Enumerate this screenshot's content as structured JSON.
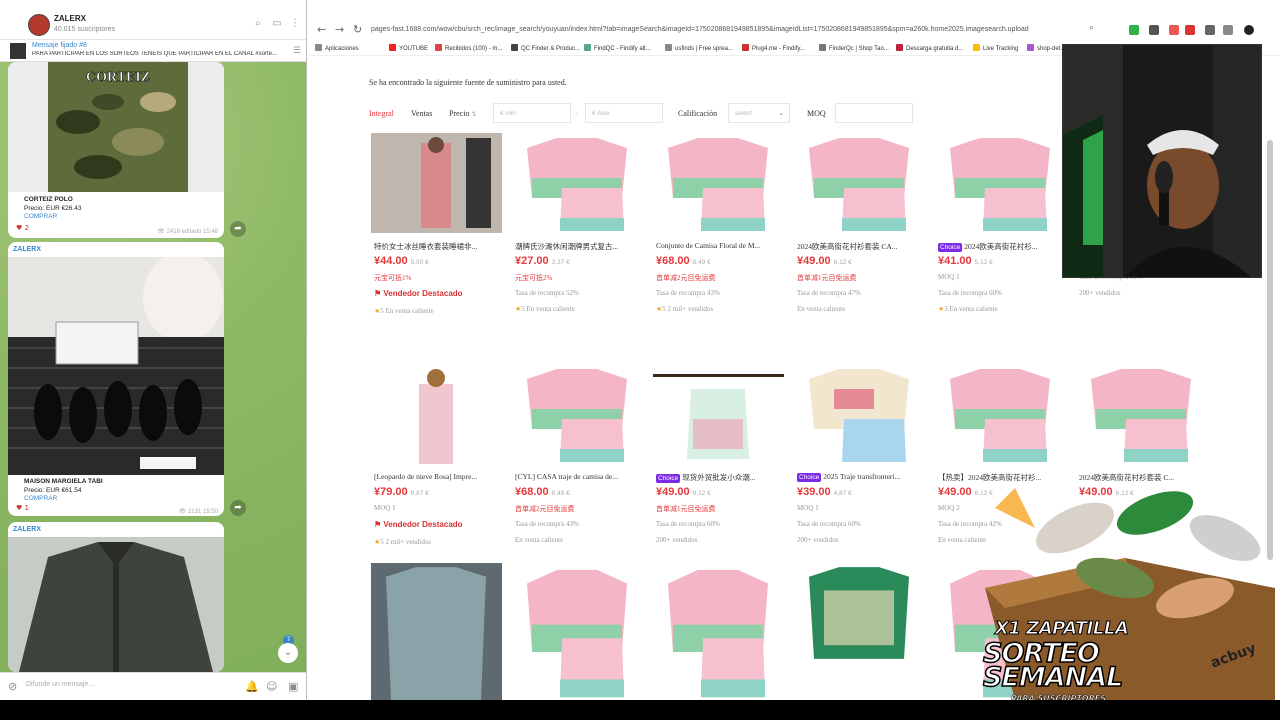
{
  "telegram": {
    "channel": "ZALERX",
    "subscribers": "40.015 suscriptores",
    "pinned_title": "Mensaje fijado #8",
    "pinned_text": "PARA PARTICIPAR EN LOS SORTEOS TENÉIS QUE PARTICIPAR EN EL CANAL #sorte...",
    "messages": [
      {
        "sender": "",
        "brand_text": "CORTEIZ",
        "name": "CORTEIZ POLO",
        "price": "Precio: EUR €26.43",
        "link": "COMPRAR",
        "views": "2419",
        "time": "editado 15:48",
        "reactions": "2"
      },
      {
        "sender": "ZALERX",
        "brand_text": "",
        "name": "MAISON MARGIELA TABI",
        "price": "Precio: EUR €61.54",
        "link": "COMPRAR",
        "views": "2131",
        "time": "15:50",
        "reactions": "1"
      },
      {
        "sender": "ZALERX",
        "brand_text": "",
        "name": "",
        "price": "",
        "link": "",
        "views": "",
        "time": "",
        "reactions": ""
      }
    ],
    "input_placeholder": "Difunde un mensaje...",
    "unread": "7"
  },
  "browser": {
    "url": "pages-fast.1688.com/wow/cbu/srch_rec/image_search/youyuan/index.html?tab=imageSearch&imageId=1750208681949851895&imageIdList=1750208681949851895&spm=a260k.home2025.imagesearch.upload",
    "bookmarks": [
      "Aplicaciones",
      "YOUTUBE",
      "Recibidos (100) - m...",
      "QC Finder & Produc...",
      "FindQC - Findify alt...",
      "usfinds | Free sprea...",
      "Plug4.me - Findify...",
      "FinderQc | Shop Tao...",
      "Descarga gratuita d...",
      "Live Tracking",
      "shop-det..."
    ]
  },
  "search": {
    "found_text": "Se ha encontrado la siguiente fuente de suministro para usted.",
    "sort_integral": "Integral",
    "sort_sales": "Ventas",
    "sort_price": "Precio",
    "min_placeholder": "€ min",
    "max_placeholder": "€ max",
    "rating_label": "Calificación",
    "rating_select": "select",
    "moq_label": "MOQ"
  },
  "products": [
    {
      "title": "特价女士冰丝睡衣套装睡裙非...",
      "price": "¥44.00",
      "old": "5,50 €",
      "promo": "元宝可抵1%",
      "seller": "Vendedor Destacado",
      "rating": "5",
      "extra": "En venta caliente",
      "choice": false,
      "moq": "",
      "rebuy": ""
    },
    {
      "title": "潮牌氏沙滩休闲潮牌男式复古...",
      "price": "¥27.00",
      "old": "3,37 €",
      "promo": "元宝可抵2%",
      "seller": "",
      "rating": "5",
      "extra": "En venta caliente",
      "choice": false,
      "moq": "",
      "rebuy": "Tasa de recompra 52%"
    },
    {
      "title": "Conjunto de Camisa Floral de M...",
      "price": "¥68.00",
      "old": "8,49 €",
      "promo": "首单减2元目免运费",
      "seller": "",
      "rating": "5",
      "extra": "2 mil+ vendidos",
      "choice": false,
      "moq": "",
      "rebuy": "Tasa de recompra 43%"
    },
    {
      "title": "2024欧美高街花衬衫套装 CA...",
      "price": "¥49.00",
      "old": "6,12 €",
      "promo": "首单减1元目免运费",
      "seller": "",
      "rating": "",
      "extra": "En venta caliente",
      "choice": false,
      "moq": "",
      "rebuy": "Tasa de recompra 47%"
    },
    {
      "title": "2024欧美高街花衬衫...",
      "price": "¥41.00",
      "old": "5,12 €",
      "promo": "",
      "seller": "",
      "rating": "3",
      "extra": "En venta caliente",
      "choice": true,
      "moq": "MOQ 1",
      "rebuy": "Tasa de recompra 60%"
    },
    {
      "title": "",
      "price": "",
      "old": "",
      "promo": "",
      "seller": "",
      "rating": "",
      "extra": "200+ vendidos",
      "choice": false,
      "moq": "",
      "rebuy": "Tasa de recompra 59%"
    },
    {
      "title": "[Leopardo de nieve Rosa] Impre...",
      "price": "¥79.00",
      "old": "9,87 €",
      "promo": "",
      "seller": "Vendedor Destacado",
      "rating": "5",
      "extra": "2 mil+ vendidos",
      "choice": false,
      "moq": "MOQ 1",
      "rebuy": ""
    },
    {
      "title": "[CYL] CASA traje de camisa de...",
      "price": "¥68.00",
      "old": "8,49 €",
      "promo": "首单减2元目免运费",
      "seller": "",
      "rating": "",
      "extra": "En venta caliente",
      "choice": false,
      "moq": "",
      "rebuy": "Tasa de recompra 43%"
    },
    {
      "title": "现货外贸批发小众潮...",
      "price": "¥49.00",
      "old": "6,12 €",
      "promo": "首单减1元目免运费",
      "seller": "",
      "rating": "",
      "extra": "200+ vendidos",
      "choice": true,
      "moq": "",
      "rebuy": "Tasa de recompra 60%"
    },
    {
      "title": "2025 Traje transfronteri...",
      "price": "¥39.00",
      "old": "4,87 €",
      "promo": "",
      "seller": "",
      "rating": "",
      "extra": "200+ vendidos",
      "choice": true,
      "moq": "MOQ 1",
      "rebuy": "Tasa de recompra 60%"
    },
    {
      "title": "【热卖】2024欧美高街花衬衫...",
      "price": "¥49.00",
      "old": "6,12 €",
      "promo": "",
      "seller": "",
      "rating": "",
      "extra": "En venta caliente",
      "choice": false,
      "moq": "MOQ 2",
      "rebuy": "Tasa de recompra 42%"
    },
    {
      "title": "2024欧美高街花衬衫套装 C...",
      "price": "¥49.00",
      "old": "6,12 €",
      "promo": "",
      "seller": "",
      "rating": "",
      "extra": "",
      "choice": false,
      "moq": "",
      "rebuy": ""
    }
  ],
  "promo": {
    "line1": "X1 ZAPATILLA",
    "line2": "SORTEO",
    "line3": "SEMANAL",
    "line4": "PARA SUSCRIPTORES",
    "brand": "acbuy"
  },
  "colors": {
    "accent": "#e4393c",
    "telegram_link": "#3a86c8",
    "choice": "#7b2ae6"
  }
}
